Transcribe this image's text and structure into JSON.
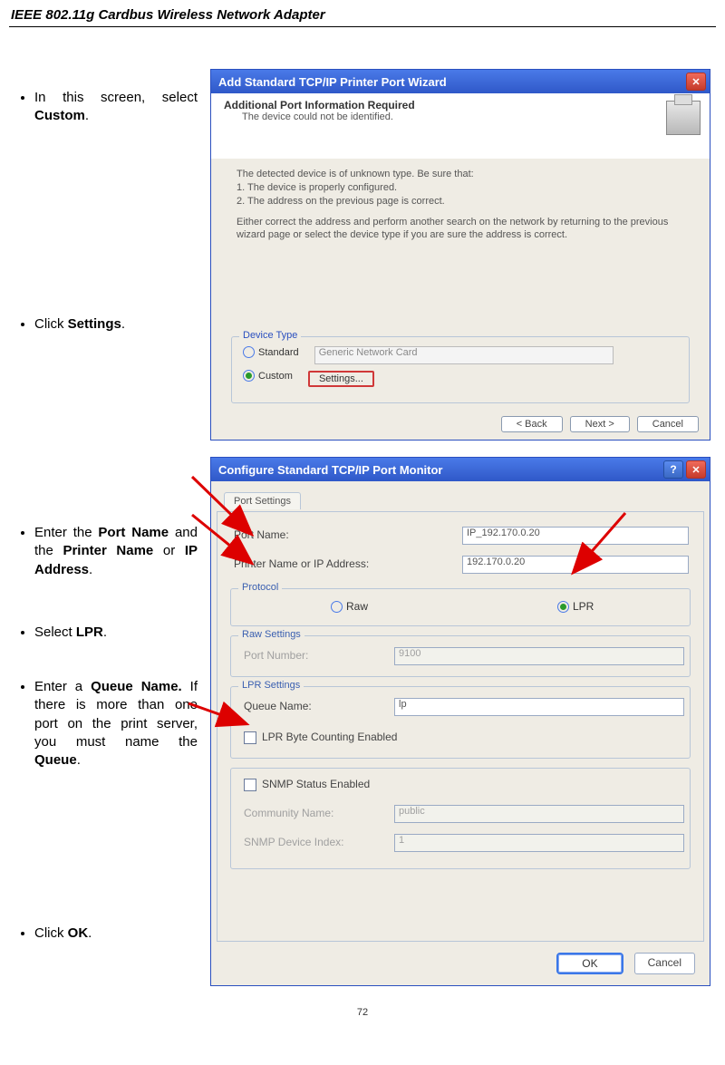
{
  "header": "IEEE 802.11g Cardbus Wireless Network Adapter",
  "steps": {
    "s1a": "In this screen, select ",
    "s1b": "Custom",
    "s2a": "Click ",
    "s2b": "Settings",
    "s3a": "Enter the ",
    "s3b": "Port Name",
    "s3c": " and the ",
    "s3d": "Printer Name",
    "s3e": " or ",
    "s3f": "IP Address",
    "s4a": "Select ",
    "s4b": "LPR",
    "s5a": "Enter a ",
    "s5b": "Queue Name.",
    "s5c": "  If there is more than one port on the print server, you must name the ",
    "s5d": "Queue",
    "s6a": "Click ",
    "s6b": "OK"
  },
  "dlg1": {
    "title": "Add Standard TCP/IP Printer Port Wizard",
    "sub1": "Additional Port Information Required",
    "sub2": "The device could not be identified.",
    "para1": "The detected device is of unknown type.  Be sure that:",
    "para2": "1. The device is properly configured.",
    "para3": "2. The address on the previous page is correct.",
    "para4": "Either correct the address and perform another search on the network by returning to the previous wizard page or select the device type if you are sure the address is correct.",
    "grp": "Device Type",
    "opt1": "Standard",
    "combo": "Generic Network Card",
    "opt2": "Custom",
    "sbtn": "Settings...",
    "b1": "< Back",
    "b2": "Next >",
    "b3": "Cancel"
  },
  "dlg2": {
    "title": "Configure Standard TCP/IP Port Monitor",
    "tab": "Port Settings",
    "l_portname": "Port Name:",
    "v_portname": "IP_192.170.0.20",
    "l_printer": "Printer Name or IP Address:",
    "v_printer": "192.170.0.20",
    "g_proto": "Protocol",
    "r_raw": "Raw",
    "r_lpr": "LPR",
    "g_raw": "Raw Settings",
    "l_rawport": "Port Number:",
    "v_rawport": "9100",
    "g_lpr": "LPR Settings",
    "l_q": "Queue Name:",
    "v_q": "lp",
    "chk_lpr": "LPR Byte Counting Enabled",
    "chk_snmp": "SNMP Status Enabled",
    "l_comm": "Community Name:",
    "v_comm": "public",
    "l_idx": "SNMP Device Index:",
    "v_idx": "1",
    "ok": "OK",
    "cancel": "Cancel"
  },
  "pagenum": "72"
}
